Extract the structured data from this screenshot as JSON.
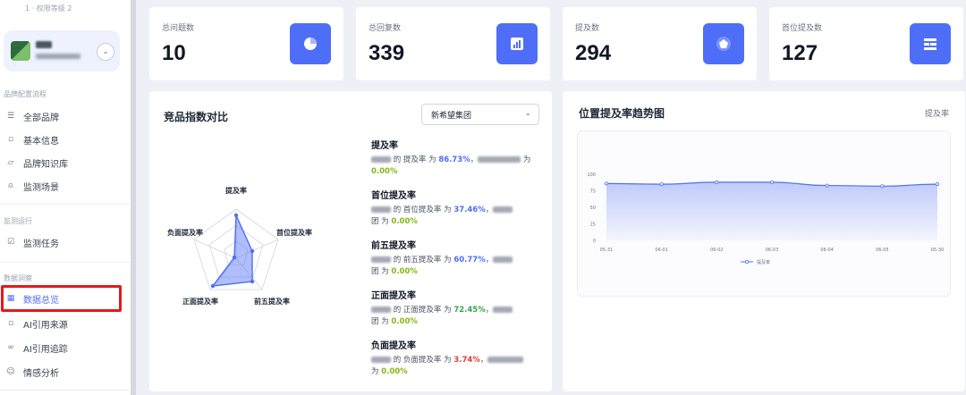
{
  "sidebar": {
    "workspace_hint": "1 · 权限等级 2",
    "sections": {
      "brand_config": "品牌配置流程",
      "monitor_run": "监测运行",
      "data_insight": "数据洞察"
    },
    "items": [
      {
        "label": "全部品牌",
        "icon": "list-icon"
      },
      {
        "label": "基本信息",
        "icon": "square-icon"
      },
      {
        "label": "品牌知识库",
        "icon": "folder-icon"
      },
      {
        "label": "监测场景",
        "icon": "person-icon"
      },
      {
        "label": "监测任务",
        "icon": "checkbox-icon"
      },
      {
        "label": "数据总览",
        "icon": "grid-icon"
      },
      {
        "label": "AI引用来源",
        "icon": "square-icon"
      },
      {
        "label": "AI引用追踪",
        "icon": "link-icon"
      },
      {
        "label": "情感分析",
        "icon": "smile-icon"
      }
    ]
  },
  "stats": [
    {
      "label": "总问题数",
      "value": "10",
      "icon": "pie-chart-icon"
    },
    {
      "label": "总回复数",
      "value": "339",
      "icon": "bar-chart-icon"
    },
    {
      "label": "提及数",
      "value": "294",
      "icon": "pentagon-icon"
    },
    {
      "label": "首位提及数",
      "value": "127",
      "icon": "table-icon"
    }
  ],
  "competitor_panel": {
    "title": "竞品指数对比",
    "select_value": "新希望集团",
    "radar_labels": [
      "提及率",
      "首位提及率",
      "前五提及率",
      "正面提及率",
      "负面提及率"
    ],
    "metrics": [
      {
        "title": "提及率",
        "text1": " 的 提及率 为 ",
        "pct1": "86.73%",
        "text2": " 为",
        "pct2": "0.00%"
      },
      {
        "title": "首位提及率",
        "text1": " 的 首位提及率 为 ",
        "pct1": "37.46%",
        "text2": "团 为 ",
        "pct2": "0.00%"
      },
      {
        "title": "前五提及率",
        "text1": " 的 前五提及率 为 ",
        "pct1": "60.77%",
        "text2": "团 为 ",
        "pct2": "0.00%"
      },
      {
        "title": "正面提及率",
        "text1": " 的 正面提及率 为 ",
        "pct1": "72.45%",
        "text2": "团 为 ",
        "pct2": "0.00%"
      },
      {
        "title": "负面提及率",
        "text1": " 的 负面提及率 为 ",
        "pct1": "3.74%",
        "text2": "为 ",
        "pct2": "0.00%"
      }
    ]
  },
  "trend_panel": {
    "title": "位置提及率趋势图",
    "legend_corner": "提及率"
  },
  "chart_data": {
    "type": "area",
    "x": [
      "05-31",
      "06-01",
      "06-02",
      "06-03",
      "06-04",
      "06-05",
      "05-30"
    ],
    "series": [
      {
        "name": "提及率",
        "values": [
          86,
          85,
          88,
          88,
          83,
          82,
          85
        ]
      }
    ],
    "yticks": [
      0,
      25,
      50,
      75,
      100
    ],
    "ylim": [
      0,
      100
    ],
    "legend_position": "bottom",
    "grid": false,
    "color": "#4f6ef7"
  },
  "colors": {
    "accent": "#4f6ef7",
    "highlight": "#e51919"
  }
}
